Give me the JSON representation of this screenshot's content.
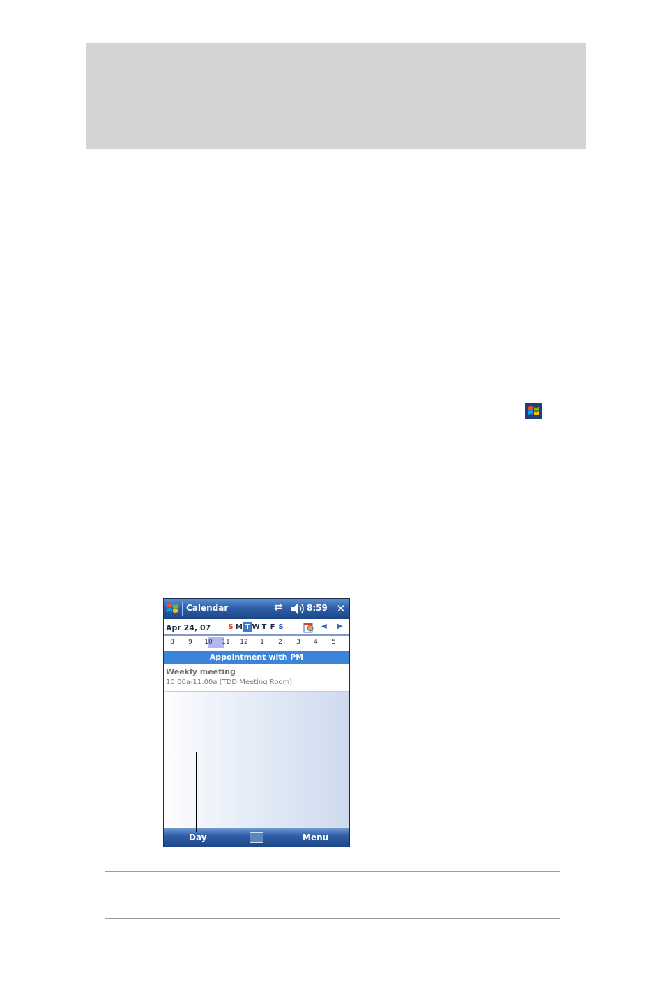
{
  "phone": {
    "title": "Calendar",
    "time": "8:59",
    "date": "Apr 24, 07",
    "weekdays": [
      "S",
      "M",
      "T",
      "W",
      "T",
      "F",
      "S"
    ],
    "hours": [
      "8",
      "9",
      "10",
      "11",
      "12",
      "1",
      "2",
      "3",
      "4",
      "5"
    ],
    "appointment_banner": "Appointment with PM",
    "event": {
      "title": "Weekly meeting",
      "time": "10:00a-11:00a  (TDD Meeting Room)"
    },
    "softkey_left": "Day",
    "softkey_right": "Menu"
  }
}
